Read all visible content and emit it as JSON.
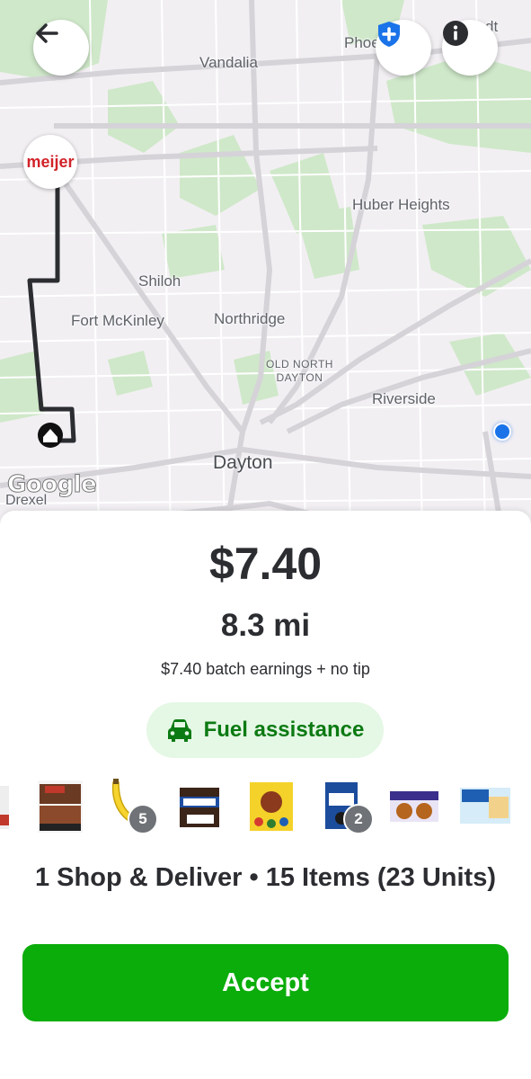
{
  "map": {
    "labels": {
      "phoenix": "Phoe",
      "dt": "dt",
      "vandalia": "Vandalia",
      "huber_heights": "Huber Heights",
      "shiloh": "Shiloh",
      "fort_mckinley": "Fort McKinley",
      "northridge": "Northridge",
      "old_north_dayton_1": "OLD NORTH",
      "old_north_dayton_2": "DAYTON",
      "riverside": "Riverside",
      "dayton": "Dayton",
      "drexel": "Drexel"
    },
    "store_logo_text": "meijer",
    "attribution": "Google",
    "colors": {
      "route": "#2b2d31",
      "store_brand": "#d2232a",
      "location_dot": "#1a73e8"
    }
  },
  "top_buttons": {
    "back_icon": "arrow-left-icon",
    "safety_icon": "shield-plus-icon",
    "info_icon": "info-icon"
  },
  "offer": {
    "price": "$7.40",
    "distance": "8.3 mi",
    "earnings_detail": "$7.40 batch earnings + no tip",
    "fuel_label": "Fuel assistance",
    "fuel_icon": "car-icon",
    "items": [
      {
        "name": "partial-product",
        "badge": null
      },
      {
        "name": "wings-bag",
        "badge": null
      },
      {
        "name": "banana",
        "badge": "5"
      },
      {
        "name": "snickers-minis",
        "badge": null
      },
      {
        "name": "mms-peanut-bag",
        "badge": null
      },
      {
        "name": "oreo-bites",
        "badge": "2"
      },
      {
        "name": "tastykake-box",
        "badge": null
      },
      {
        "name": "toaster-pastry-box",
        "badge": null
      }
    ],
    "summary": "1 Shop & Deliver • 15 Items (23 Units)",
    "accept_label": "Accept"
  },
  "colors": {
    "accept": "#0aad0a",
    "fuel_chip_bg": "#e5f7e5",
    "fuel_text": "#0b7a12"
  }
}
